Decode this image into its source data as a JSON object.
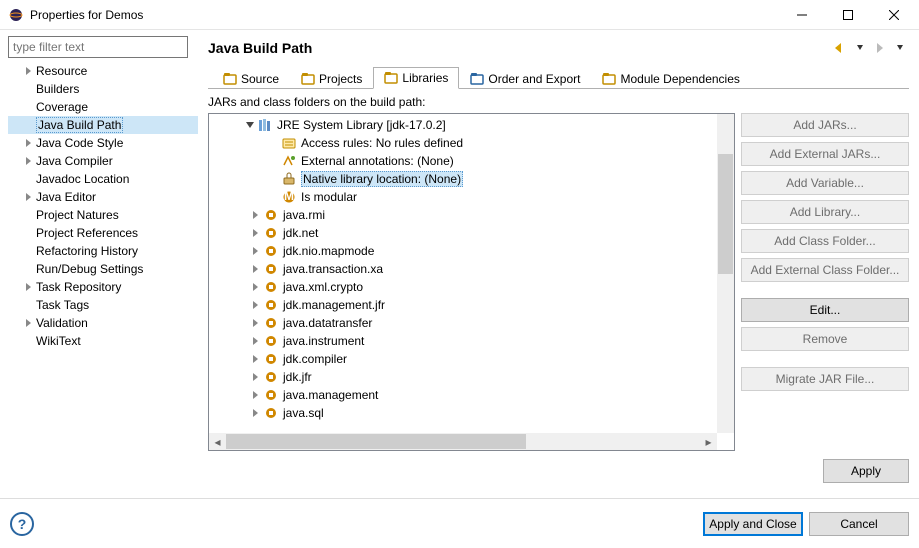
{
  "window": {
    "title": "Properties for Demos",
    "help_symbol": "?"
  },
  "sidebar": {
    "filter_placeholder": "type filter text",
    "items": [
      {
        "label": "Resource",
        "hasChildren": true
      },
      {
        "label": "Builders",
        "hasChildren": false
      },
      {
        "label": "Coverage",
        "hasChildren": false
      },
      {
        "label": "Java Build Path",
        "hasChildren": false,
        "selected": true
      },
      {
        "label": "Java Code Style",
        "hasChildren": true
      },
      {
        "label": "Java Compiler",
        "hasChildren": true
      },
      {
        "label": "Javadoc Location",
        "hasChildren": false
      },
      {
        "label": "Java Editor",
        "hasChildren": true
      },
      {
        "label": "Project Natures",
        "hasChildren": false
      },
      {
        "label": "Project References",
        "hasChildren": false
      },
      {
        "label": "Refactoring History",
        "hasChildren": false
      },
      {
        "label": "Run/Debug Settings",
        "hasChildren": false
      },
      {
        "label": "Task Repository",
        "hasChildren": true
      },
      {
        "label": "Task Tags",
        "hasChildren": false
      },
      {
        "label": "Validation",
        "hasChildren": true
      },
      {
        "label": "WikiText",
        "hasChildren": false
      }
    ]
  },
  "header": {
    "title": "Java Build Path"
  },
  "tabs": [
    {
      "label": "Source",
      "icon": "source"
    },
    {
      "label": "Projects",
      "icon": "projects"
    },
    {
      "label": "Libraries",
      "icon": "libraries",
      "active": true
    },
    {
      "label": "Order and Export",
      "icon": "order"
    },
    {
      "label": "Module Dependencies",
      "icon": "module"
    }
  ],
  "jars_label": "JARs and class folders on the build path:",
  "lib_tree": {
    "root": {
      "label": "JRE System Library [jdk-17.0.2]",
      "icon": "lib"
    },
    "meta": [
      {
        "label": "Access rules: No rules defined",
        "icon": "access"
      },
      {
        "label": "External annotations: (None)",
        "icon": "extann"
      },
      {
        "label": "Native library location: (None)",
        "icon": "native",
        "selected": true
      },
      {
        "label": "Is modular",
        "icon": "modular"
      }
    ],
    "modules": [
      "java.rmi",
      "jdk.net",
      "jdk.nio.mapmode",
      "java.transaction.xa",
      "java.xml.crypto",
      "jdk.management.jfr",
      "java.datatransfer",
      "java.instrument",
      "jdk.compiler",
      "jdk.jfr",
      "java.management",
      "java.sql"
    ]
  },
  "side_buttons": {
    "g1": [
      {
        "label": "Add JARs...",
        "enabled": false
      },
      {
        "label": "Add External JARs...",
        "enabled": false
      },
      {
        "label": "Add Variable...",
        "enabled": false
      },
      {
        "label": "Add Library...",
        "enabled": false
      },
      {
        "label": "Add Class Folder...",
        "enabled": false
      },
      {
        "label": "Add External Class Folder...",
        "enabled": false
      }
    ],
    "g2": [
      {
        "label": "Edit...",
        "enabled": true
      },
      {
        "label": "Remove",
        "enabled": false
      }
    ],
    "g3": [
      {
        "label": "Migrate JAR File...",
        "enabled": false
      }
    ]
  },
  "footer": {
    "apply": "Apply",
    "apply_close": "Apply and Close",
    "cancel": "Cancel"
  }
}
